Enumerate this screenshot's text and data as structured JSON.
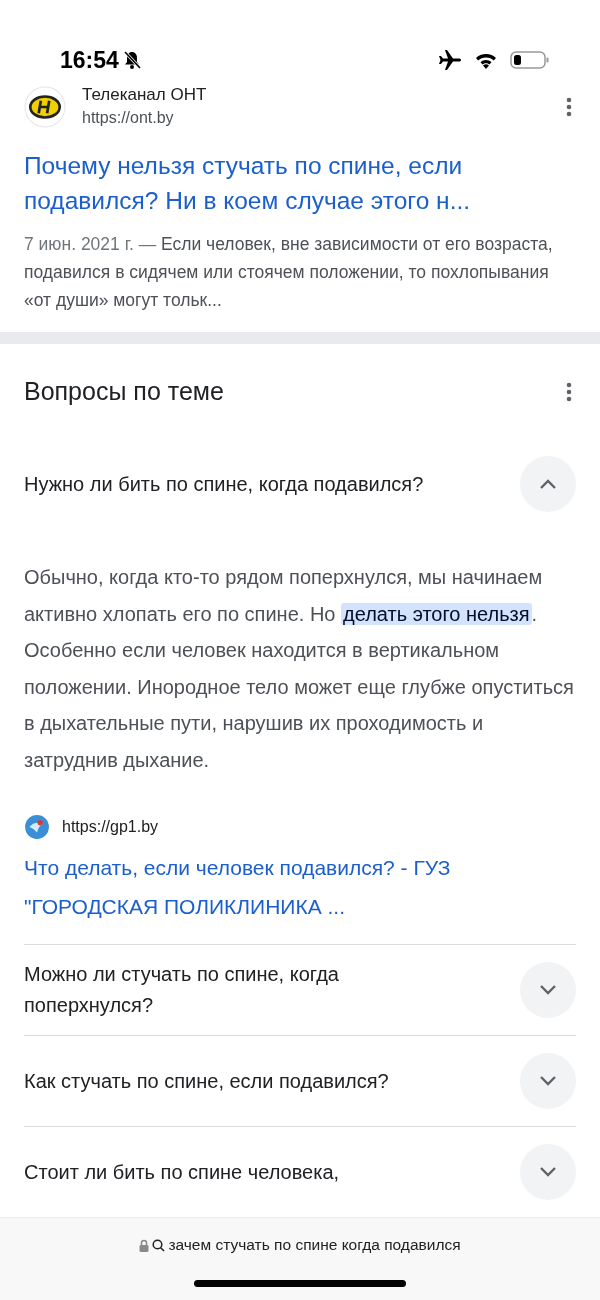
{
  "status_bar": {
    "time": "16:54"
  },
  "result": {
    "source_name": "Телеканал ОНТ",
    "url": "https://ont.by",
    "title": "Почему нельзя стучать по спине, если подавился? Ни в коем случае этого н...",
    "snippet_date": "7 июн. 2021 г. —",
    "snippet": "Если человек, вне зависимости от его возраста, подавился в сидячем или стоячем положении, то похлопывания «от души» могут тольк..."
  },
  "questions_section": {
    "heading": "Вопросы по теме",
    "questions": [
      {
        "question": "Нужно ли бить по спине, когда подавился?",
        "expanded": true,
        "answer": {
          "before": "Обычно, когда кто-то рядом поперхнулся, мы начинаем активно хлопать его по спине. Но ",
          "highlight": "делать этого нельзя",
          "after": ". Особенно если человек находится в вертикальном положении. Инородное тело может еще глубже опуститься в дыхательные пути, нарушив их проходимость и затруднив дыхание."
        },
        "source_url": "https://gp1.by",
        "source_title": "Что делать, если человек подавился? - ГУЗ \"ГОРОДСКАЯ ПОЛИКЛИНИКА ..."
      },
      {
        "question": "Можно ли стучать по спине, когда поперхнулся?",
        "expanded": false
      },
      {
        "question": "Как стучать по спине, если подавился?",
        "expanded": false
      },
      {
        "question": "Стоит ли бить по спине человека,",
        "expanded": false
      }
    ]
  },
  "address_bar": {
    "query": "зачем стучать по спине когда подавился"
  }
}
